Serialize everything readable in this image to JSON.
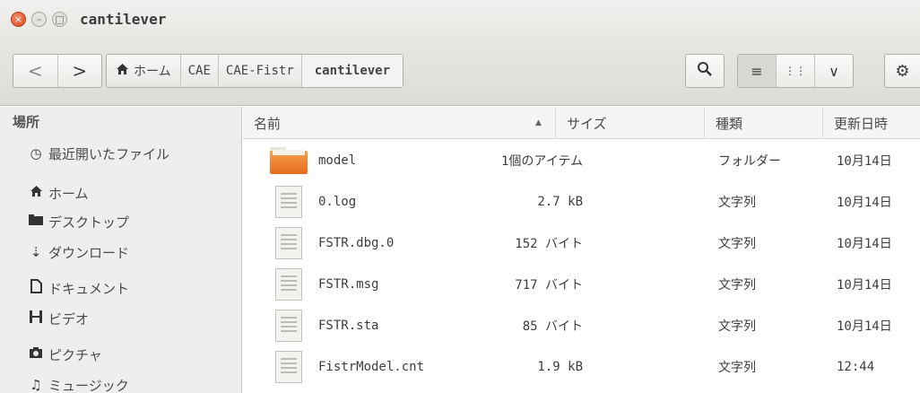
{
  "window": {
    "title": "cantilever",
    "close_glyph": "×",
    "minimize_glyph": "–",
    "maximize_glyph": "□"
  },
  "toolbar": {
    "back_glyph": "<",
    "forward_glyph": ">",
    "breadcrumbs": [
      {
        "label": "ホーム",
        "icon": "home-icon"
      },
      {
        "label": "CAE"
      },
      {
        "label": "CAE-Fistr"
      },
      {
        "label": "cantilever"
      }
    ],
    "search_glyph": "🔍",
    "list_view_glyph": "≡",
    "grid_view_glyph": "⋮⋮",
    "dropdown_glyph": "∨",
    "settings_glyph": "⚙"
  },
  "sidebar": {
    "heading": "場所",
    "items": [
      {
        "label": "最近開いたファイル",
        "icon": "clock-icon",
        "glyph": "◷"
      },
      {
        "label": "ホーム",
        "icon": "home-icon",
        "glyph": "⌂"
      },
      {
        "label": "デスクトップ",
        "icon": "desktop-icon",
        "glyph": "▬"
      },
      {
        "label": "ダウンロード",
        "icon": "download-icon",
        "glyph": "⇣"
      },
      {
        "label": "ドキュメント",
        "icon": "document-icon",
        "glyph": "▯"
      },
      {
        "label": "ビデオ",
        "icon": "video-icon",
        "glyph": "▤"
      },
      {
        "label": "ピクチャ",
        "icon": "camera-icon",
        "glyph": "◙"
      },
      {
        "label": "ミュージック",
        "icon": "music-icon",
        "glyph": "♫"
      }
    ]
  },
  "columns": {
    "name": "名前",
    "size": "サイズ",
    "type": "種類",
    "modified": "更新日時",
    "sort_glyph": "▲"
  },
  "files": [
    {
      "name": "model",
      "size": "1個のアイテム",
      "type": "フォルダー",
      "modified": "10月14日",
      "icon": "folder-icon"
    },
    {
      "name": "0.log",
      "size": "2.7 kB",
      "type": "文字列",
      "modified": "10月14日",
      "icon": "text-file-icon"
    },
    {
      "name": "FSTR.dbg.0",
      "size": "152 バイト",
      "type": "文字列",
      "modified": "10月14日",
      "icon": "text-file-icon"
    },
    {
      "name": "FSTR.msg",
      "size": "717 バイト",
      "type": "文字列",
      "modified": "10月14日",
      "icon": "text-file-icon"
    },
    {
      "name": "FSTR.sta",
      "size": "85 バイト",
      "type": "文字列",
      "modified": "10月14日",
      "icon": "text-file-icon"
    },
    {
      "name": "FistrModel.cnt",
      "size": "1.9 kB",
      "type": "文字列",
      "modified": "12:44",
      "icon": "text-file-icon"
    }
  ]
}
